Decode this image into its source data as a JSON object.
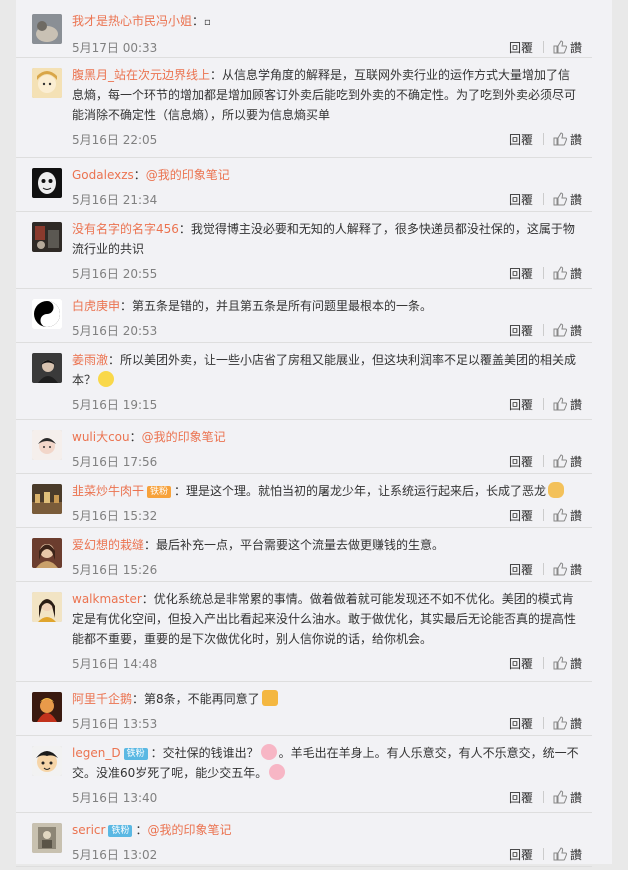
{
  "actions": {
    "reply": "回覆",
    "like": "讚"
  },
  "comments": [
    {
      "name": "我才是热心市民冯小姐",
      "sep": "：",
      "text": "",
      "time": "5月17日 00:33"
    },
    {
      "name": "腹黑月_站在次元边界线上",
      "sep": "：",
      "text": "从信息学角度的解释是，互联网外卖行业的运作方式大量增加了信息熵，每一个环节的增加都是增加顾客订外卖后能吃到外卖的不确定性。为了吃到外卖必须尽可能消除不确定性（信息熵），所以要为信息熵买单",
      "time": "5月16日 22:05"
    },
    {
      "name": "Godalexzs",
      "sep": "：",
      "mention": "@我的印象笔记",
      "text": "",
      "time": "5月16日 21:34"
    },
    {
      "name": "没有名字的名字456",
      "sep": "：",
      "text": "我觉得博主没必要和无知的人解释了，很多快递员都没社保的，这属于物流行业的共识",
      "time": "5月16日 20:55"
    },
    {
      "name": "白虎庚申",
      "sep": "：",
      "text": "第五条是错的，并且第五条是所有问题里最根本的一条。",
      "time": "5月16日 20:53"
    },
    {
      "name": "姜雨澈",
      "sep": "：",
      "text": "所以美团外卖，让一些小店省了房租又能展业，但这块利润率不足以覆盖美团的相关成本？",
      "time": "5月16日 19:15"
    },
    {
      "name": "wuli大cou",
      "sep": "：",
      "mention": "@我的印象笔记",
      "text": "",
      "time": "5月16日 17:56"
    },
    {
      "name": "韭菜炒牛肉干",
      "badge": "铁粉",
      "sep": "：",
      "text": "理是这个理。就怕当初的屠龙少年，让系统运行起来后，长成了恶龙",
      "time": "5月16日 15:32"
    },
    {
      "name": "爱幻想的栽缝",
      "sep": "：",
      "text": "最后补充一点，平台需要这个流量去做更赚钱的生意。",
      "time": "5月16日 15:26"
    },
    {
      "name": "walkmaster",
      "sep": "：",
      "text": "优化系统总是非常累的事情。做着做着就可能发现还不如不优化。美团的模式肯定是有优化空间，但投入产出比看起来没什么油水。敢于做优化，其实最后无论能否真的提高性能都不重要，重要的是下次做优化时，别人信你说的话，给你机会。",
      "time": "5月16日 14:48"
    },
    {
      "name": "阿里千企鹅",
      "sep": "：",
      "text": "第8条，不能再同意了",
      "time": "5月16日 13:53"
    },
    {
      "name": "legen_D",
      "badge": "铁粉",
      "sep": "：",
      "text": "交社保的钱谁出？",
      "text2": "。羊毛出在羊身上。有人乐意交，有人不乐意交，统一不交。没准60岁死了呢，能少交五年。",
      "time": "5月16日 13:40"
    },
    {
      "name": "sericr",
      "badge": "铁粉",
      "sep": "：",
      "mention": "@我的印象笔记",
      "text": "",
      "time": "5月16日 13:02"
    }
  ]
}
